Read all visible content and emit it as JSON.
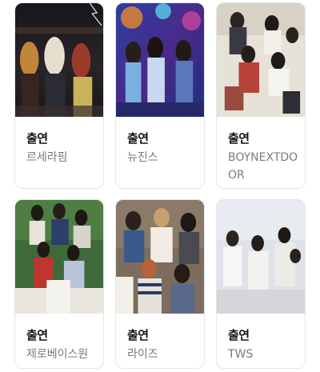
{
  "cards": [
    {
      "role": "출연",
      "name": "르세라핌",
      "photo": "group-photo"
    },
    {
      "role": "출연",
      "name": "뉴진스",
      "photo": "group-photo"
    },
    {
      "role": "출연",
      "name": "BOYNEXTDOOR",
      "photo": "group-photo"
    },
    {
      "role": "출연",
      "name": "제로베이스원",
      "photo": "group-photo"
    },
    {
      "role": "출연",
      "name": "라이즈",
      "photo": "group-photo"
    },
    {
      "role": "출연",
      "name": "TWS",
      "photo": "group-photo"
    }
  ],
  "colors": {
    "border": "#e4e6ea",
    "role_text": "#111111",
    "name_text": "#777b80"
  }
}
